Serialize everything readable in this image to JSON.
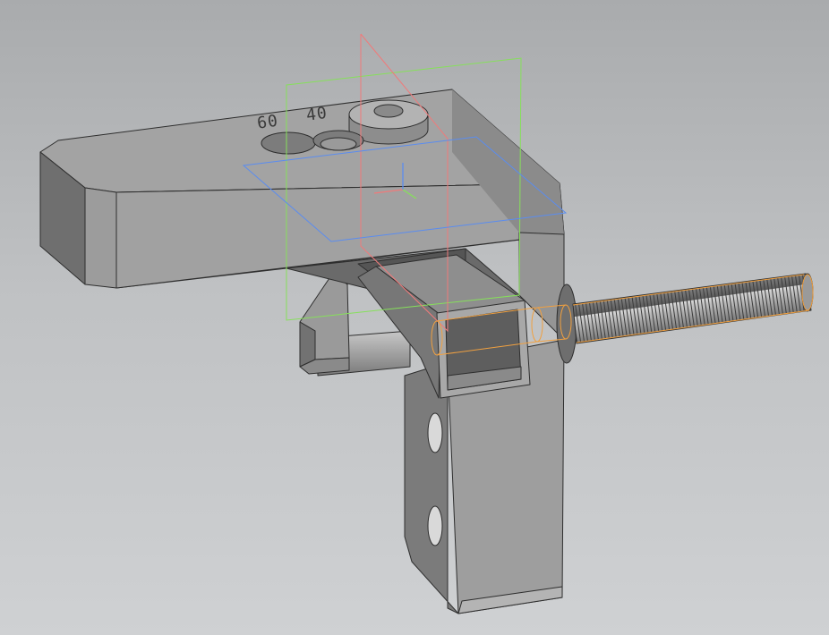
{
  "viewport": {
    "background_top": "#a9abad",
    "background_bottom": "#cfd1d3"
  },
  "model": {
    "engravings": [
      "60",
      "40"
    ],
    "part_color": "#9a9a9a",
    "edge_color": "#2e2e2e"
  },
  "origin_planes": {
    "front_plane_color": "#86e05a",
    "right_plane_color": "#f07a7a",
    "top_plane_color": "#5a8cf0"
  },
  "highlight": {
    "selected_color": "#f0a040"
  }
}
